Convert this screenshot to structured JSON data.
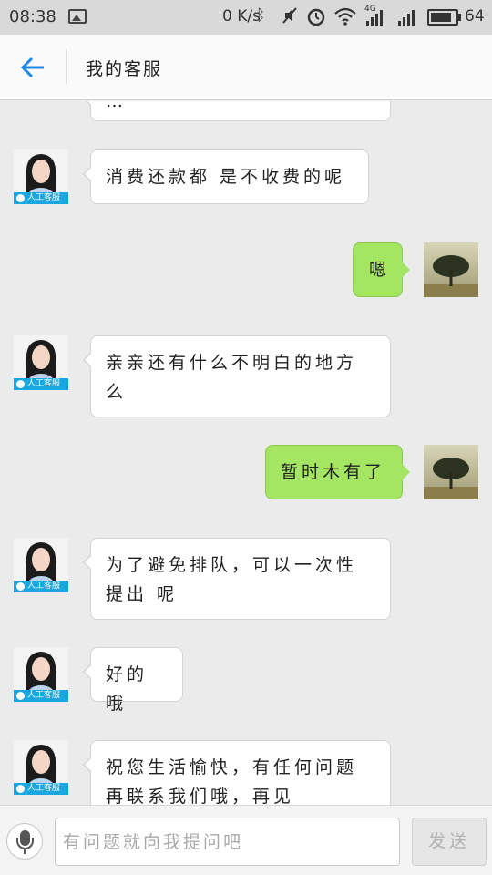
{
  "status_bar": {
    "time": "08:38",
    "net_speed": "0 K/s",
    "network_type": "4G",
    "battery_percent": "64",
    "icons": [
      "image-icon",
      "bluetooth-icon",
      "mute-icon",
      "alarm-icon",
      "wifi-icon",
      "signal-4g-icon",
      "signal-icon",
      "battery-icon"
    ]
  },
  "header": {
    "title": "我的客服",
    "back_icon": "arrow-left-icon",
    "accent_color": "#1e88e5"
  },
  "agent": {
    "badge_label": "人工客服",
    "badge_color": "#1aa6df"
  },
  "messages": [
    {
      "from": "agent",
      "text": "…"
    },
    {
      "from": "agent",
      "text": "消费还款都 是不收费的呢"
    },
    {
      "from": "user",
      "text": "嗯"
    },
    {
      "from": "agent",
      "text": "亲亲还有什么不明白的地方么"
    },
    {
      "from": "user",
      "text": "暂时木有了"
    },
    {
      "from": "agent",
      "text": "为了避免排队，可以一次性提出 呢"
    },
    {
      "from": "agent",
      "text": "好的哦"
    },
    {
      "from": "agent",
      "text": "祝您生活愉快，有任何问题再联系我们哦，再见"
    }
  ],
  "input_bar": {
    "placeholder": "有问题就向我提问吧",
    "value": "",
    "send_label": "发送",
    "voice_icon": "microphone-icon"
  },
  "colors": {
    "user_bubble": "#a4e561",
    "agent_bubble": "#ffffff",
    "chat_background": "#ebebeb"
  }
}
